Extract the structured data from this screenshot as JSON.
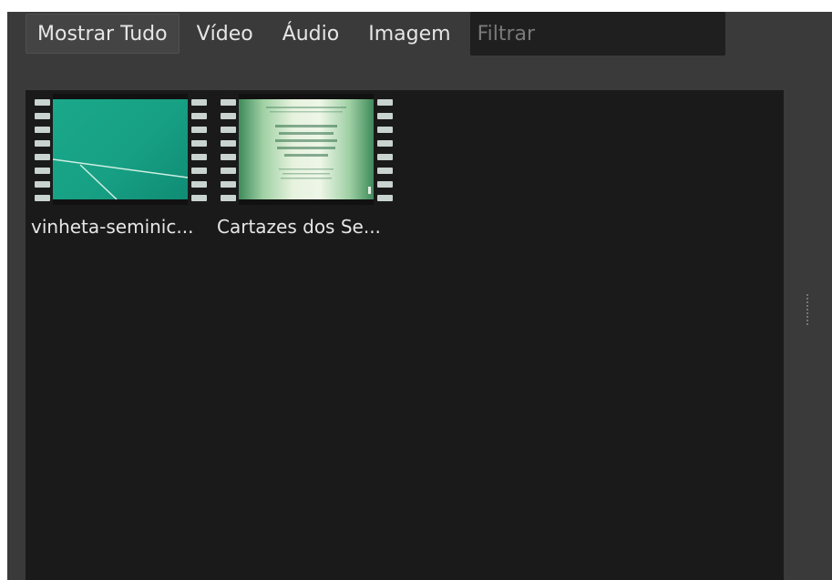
{
  "toolbar": {
    "show_all_label": "Mostrar Tudo",
    "video_label": "Vídeo",
    "audio_label": "Áudio",
    "image_label": "Imagem",
    "filter_placeholder": "Filtrar",
    "filter_value": ""
  },
  "items": [
    {
      "label": "vinheta-seminic...",
      "type": "video"
    },
    {
      "label": "Cartazes dos Se...",
      "type": "video"
    }
  ],
  "colors": {
    "panel_bg": "#3a3a3a",
    "content_bg": "#1a1a1a",
    "text": "#e6e6e6",
    "thumb_teal": "#1aa88a"
  }
}
